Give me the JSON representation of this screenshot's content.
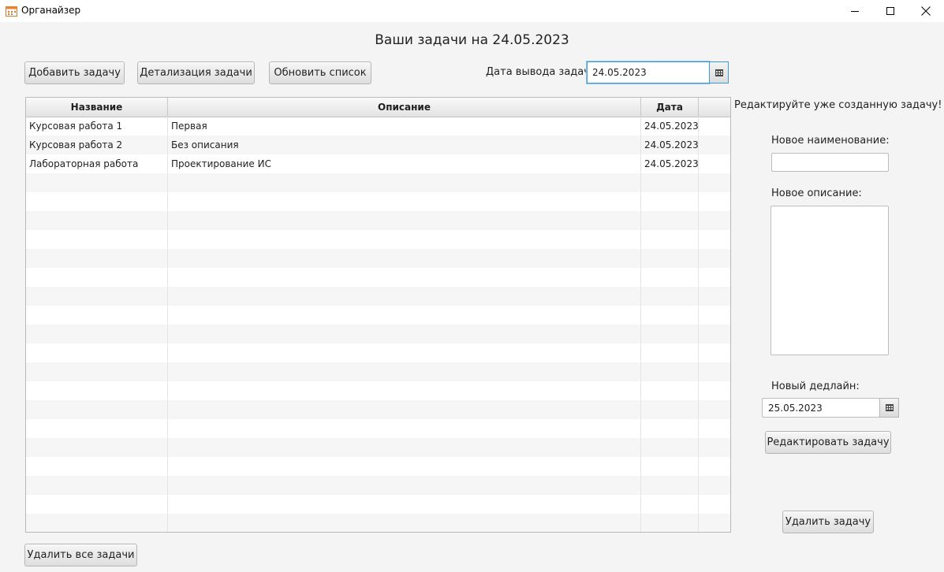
{
  "window": {
    "title": "Органайзер"
  },
  "header": {
    "title": "Ваши задачи на 24.05.2023"
  },
  "toolbar": {
    "add_label": "Добавить задачу",
    "details_label": "Детализация задачи",
    "refresh_label": "Обновить список",
    "date_label": "Дата вывода задач:",
    "date_value": "24.05.2023"
  },
  "table": {
    "columns": [
      "Название",
      "Описание",
      "Дата"
    ],
    "rows": [
      [
        "Курсовая работа 1",
        "Первая",
        "24.05.2023"
      ],
      [
        "Курсовая работа 2",
        "Без описания",
        "24.05.2023"
      ],
      [
        "Лабораторная работа",
        "Проектирование ИС",
        "24.05.2023"
      ]
    ]
  },
  "edit_panel": {
    "heading": "Редактируйте уже созданную задачу!",
    "name_label": "Новое наименование:",
    "name_value": "",
    "desc_label": "Новое описание:",
    "desc_value": "",
    "deadline_label": "Новый дедлайн:",
    "deadline_value": "25.05.2023",
    "edit_label": "Редактировать задачу",
    "delete_label": "Удалить задачу"
  },
  "footer": {
    "delete_all_label": "Удалить все задачи"
  }
}
